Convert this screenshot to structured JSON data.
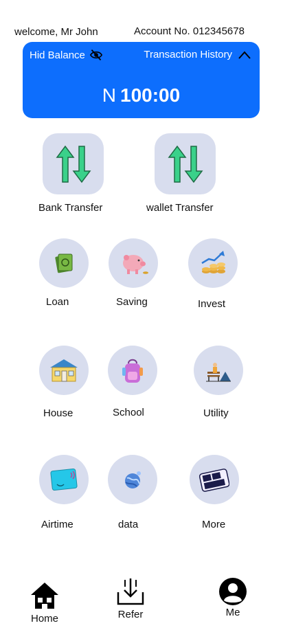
{
  "header": {
    "welcome": "welcome, Mr John",
    "account": "Account No. 012345678"
  },
  "balance_card": {
    "hide_label": "Hid Balance",
    "history_label": "Transaction History",
    "currency": "N",
    "amount": "100:00",
    "bg_color": "#0d6efd"
  },
  "transfers": [
    {
      "label": "Bank Transfer",
      "icon": "transfer-arrows-icon"
    },
    {
      "label": "wallet Transfer",
      "icon": "transfer-arrows-icon"
    }
  ],
  "services": [
    {
      "label": "Loan",
      "icon": "cash-icon"
    },
    {
      "label": "Saving",
      "icon": "piggy-bank-icon"
    },
    {
      "label": "Invest",
      "icon": "growth-coins-icon"
    },
    {
      "label": "House",
      "icon": "house-icon"
    },
    {
      "label": "School",
      "icon": "backpack-icon"
    },
    {
      "label": "Utility",
      "icon": "park-bench-icon"
    },
    {
      "label": "Airtime",
      "icon": "sim-card-icon"
    },
    {
      "label": "data",
      "icon": "globe-icon"
    },
    {
      "label": "More",
      "icon": "do-more-icon"
    }
  ],
  "bottom_nav": [
    {
      "label": "Home",
      "icon": "home-icon"
    },
    {
      "label": "Refer",
      "icon": "inbox-download-icon"
    },
    {
      "label": "Me",
      "icon": "user-avatar-icon"
    }
  ]
}
